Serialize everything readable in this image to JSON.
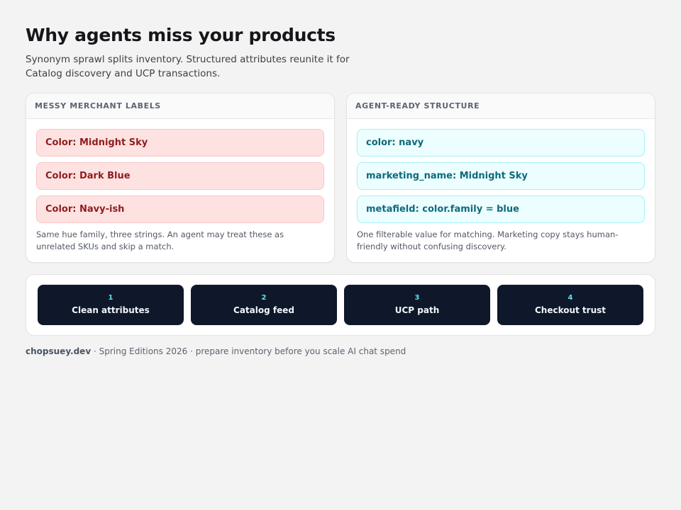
{
  "header": {
    "title": "Why agents miss your products",
    "subtitle": "Synonym sprawl splits inventory. Structured attributes reunite it for Catalog discovery and UCP transactions."
  },
  "messy_panel": {
    "heading": "MESSY MERCHANT LABELS",
    "labels": [
      "Color: Midnight Sky",
      "Color: Dark Blue",
      "Color: Navy-ish"
    ],
    "note": "Same hue family, three strings. An agent may treat these as unrelated SKUs and skip a match."
  },
  "structured_panel": {
    "heading": "AGENT-READY STRUCTURE",
    "labels": [
      "color: navy",
      "marketing_name: Midnight Sky",
      "metafield: color.family = blue"
    ],
    "note": "One filterable value for matching. Marketing copy stays human-friendly without confusing discovery."
  },
  "steps": [
    {
      "number": "1",
      "label": "Clean attributes"
    },
    {
      "number": "2",
      "label": "Catalog feed"
    },
    {
      "number": "3",
      "label": "UCP path"
    },
    {
      "number": "4",
      "label": "Checkout trust"
    }
  ],
  "footer": {
    "brand": "chopsuey.dev",
    "text": " · Spring Editions 2026 · prepare inventory before you scale AI chat spend"
  },
  "colors": {
    "background": "#f3f3f3",
    "messy_chip_bg": "#fee2e2",
    "messy_chip_text": "#8f1d1d",
    "clean_chip_bg": "#ecfeff",
    "clean_chip_text": "#0e6a7c",
    "step_bg": "#0f172a",
    "step_number": "#5ee0ef"
  }
}
